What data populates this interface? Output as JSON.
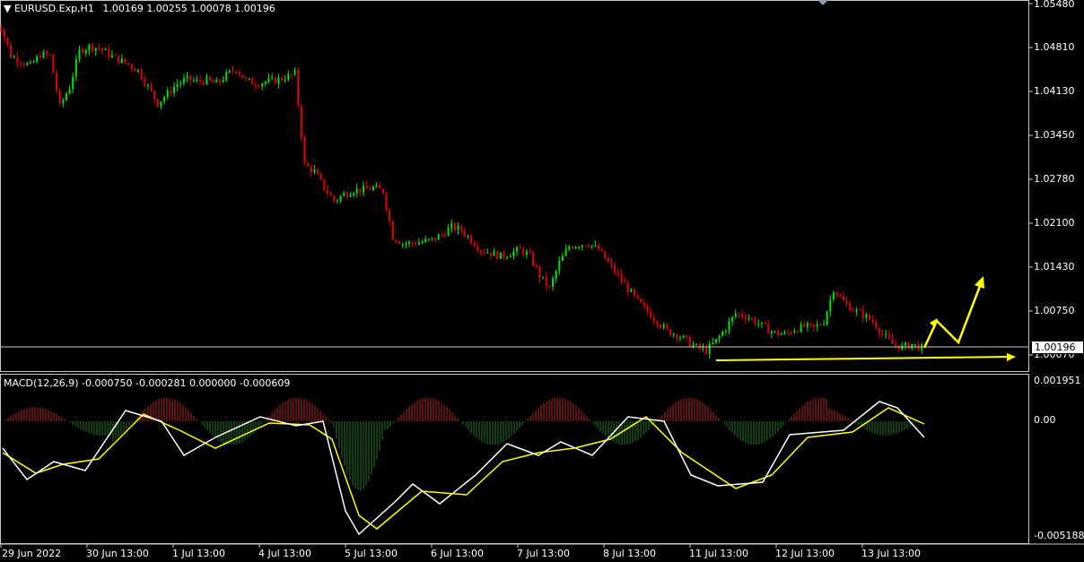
{
  "header": {
    "symbol_timeframe": "EURUSD.Exp,H1",
    "ohlc": "1.00169 1.00255 1.00078 1.00196"
  },
  "indicator": {
    "label": "MACD(12,26,9) -0.000750 -0.000281 0.000000 -0.000609"
  },
  "price_axis": {
    "labels": [
      "1.05480",
      "1.04810",
      "1.04130",
      "1.03450",
      "1.02780",
      "1.02100",
      "1.01430",
      "1.00750",
      "1.00070"
    ],
    "current_price": "1.00196"
  },
  "macd_axis": {
    "labels": [
      "0.001951",
      "0.00",
      "-0.005188"
    ]
  },
  "time_axis": {
    "labels": [
      "29 Jun 2022",
      "30 Jun 13:00",
      "1 Jul 13:00",
      "4 Jul 13:00",
      "5 Jul 13:00",
      "6 Jul 13:00",
      "7 Jul 13:00",
      "8 Jul 13:00",
      "11 Jul 13:00",
      "12 Jul 13:00",
      "13 Jul 13:00"
    ]
  },
  "colors": {
    "background": "#000000",
    "bull": "#00e600",
    "bear": "#e60000",
    "macd_line": "#ffffff",
    "signal_line": "#ffff00",
    "annotation": "#ffff00"
  },
  "chart_data": {
    "type": "candlestick",
    "price_path_close": [
      1.0512,
      1.0468,
      1.046,
      1.0452,
      1.047,
      1.0468,
      1.039,
      1.042,
      1.0475,
      1.0482,
      1.048,
      1.047,
      1.0462,
      1.0455,
      1.0445,
      1.042,
      1.0395,
      1.041,
      1.0425,
      1.0432,
      1.0428,
      1.043,
      1.0425,
      1.0438,
      1.0448,
      1.043,
      1.0425,
      1.0428,
      1.043,
      1.0435,
      1.044,
      1.03,
      1.029,
      1.0265,
      1.0245,
      1.0255,
      1.0262,
      1.0262,
      1.0265,
      1.026,
      1.019,
      1.018,
      1.018,
      1.0182,
      1.0185,
      1.0193,
      1.0205,
      1.02,
      1.0185,
      1.017,
      1.0165,
      1.016,
      1.0165,
      1.017,
      1.016,
      1.013,
      1.011,
      1.015,
      1.0175,
      1.0178,
      1.018,
      1.017,
      1.015,
      1.013,
      1.011,
      1.009,
      1.0075,
      1.006,
      1.0045,
      1.004,
      1.003,
      1.002,
      1.0015,
      1.003,
      1.005,
      1.0072,
      1.0068,
      1.006,
      1.005,
      1.0042,
      1.004,
      1.0048,
      1.0052,
      1.005,
      1.006,
      1.011,
      1.009,
      1.0078,
      1.007,
      1.006,
      1.004,
      1.0025,
      1.002,
      1.0025,
      1.0019
    ],
    "annotations": [
      "horizontal support line near 1.0007",
      "zigzag projection arrow up to ~1.0125"
    ]
  }
}
